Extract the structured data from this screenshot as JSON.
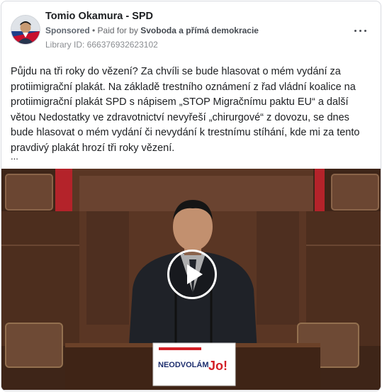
{
  "header": {
    "page_name": "Tomio Okamura - SPD",
    "sponsored_label": "Sponsored",
    "separator": " • ",
    "paid_for_prefix": "Paid for by ",
    "sponsor_name": "Svoboda a přímá demokracie",
    "library_id": "Library ID: 666376932623102"
  },
  "post": {
    "text": "Půjdu na tři roky do vězení? Za chvíli se bude hlasovat o mém vydání za protiimigrační plakát. Na základě trestního oznámení z řad vládní koalice na protiimigrační plakát SPD s nápisem „STOP Migračnímu paktu EU“ a další větou Nedostatky ve zdravotnictví nevyřeší „chirurgové“ z dovozu, se dnes bude hlasovat o mém vydání či nevydání k trestnímu stíhání, kde mi za tento pravdivý plakát hrozí tři roky vězení.",
    "see_more": "..."
  },
  "video": {
    "sign_text": "NEODVOLÁM",
    "sign_badge": "Jo!",
    "icons": {
      "play": "play-icon",
      "more": "more-options-icon"
    }
  }
}
